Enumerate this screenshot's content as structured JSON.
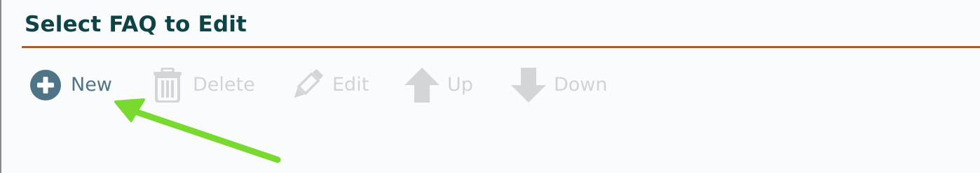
{
  "page": {
    "title": "Select FAQ to Edit"
  },
  "toolbar": {
    "items": [
      {
        "id": "new",
        "label": "New",
        "icon": "plus-circle-icon",
        "enabled": true
      },
      {
        "id": "delete",
        "label": "Delete",
        "icon": "trash-icon",
        "enabled": false
      },
      {
        "id": "edit",
        "label": "Edit",
        "icon": "pencil-icon",
        "enabled": false
      },
      {
        "id": "up",
        "label": "Up",
        "icon": "arrow-up-icon",
        "enabled": false
      },
      {
        "id": "down",
        "label": "Down",
        "icon": "arrow-down-icon",
        "enabled": false
      }
    ]
  },
  "colors": {
    "title": "#0f4447",
    "title_rule": "#a95e2f",
    "enabled": "#4f7488",
    "disabled": "#cfd4d8",
    "annotation_arrow": "#78d92e",
    "background": "#fafbfc"
  },
  "annotation": {
    "icon": "pointer-arrow-icon",
    "target": "new"
  }
}
